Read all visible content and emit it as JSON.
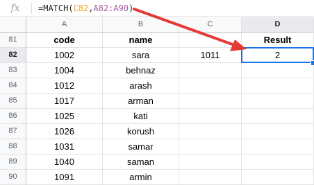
{
  "formula_bar": {
    "fx_icon": "fx-icon",
    "prefix": "=MATCH(",
    "ref1": "C82",
    "sep": ",",
    "ref2": "A82:A90",
    "suffix": ")"
  },
  "columns": [
    "A",
    "B",
    "C",
    "D"
  ],
  "rows": [
    {
      "num": "81",
      "a": "code",
      "b": "name",
      "c": "",
      "d": "Result"
    },
    {
      "num": "82",
      "a": "1002",
      "b": "sara",
      "c": "1011",
      "d": "2"
    },
    {
      "num": "83",
      "a": "1004",
      "b": "behnaz",
      "c": "",
      "d": ""
    },
    {
      "num": "84",
      "a": "1012",
      "b": "arash",
      "c": "",
      "d": ""
    },
    {
      "num": "85",
      "a": "1017",
      "b": "arman",
      "c": "",
      "d": ""
    },
    {
      "num": "86",
      "a": "1025",
      "b": "kati",
      "c": "",
      "d": ""
    },
    {
      "num": "87",
      "a": "1026",
      "b": "korush",
      "c": "",
      "d": ""
    },
    {
      "num": "88",
      "a": "1031",
      "b": "samar",
      "c": "",
      "d": ""
    },
    {
      "num": "89",
      "a": "1040",
      "b": "saman",
      "c": "",
      "d": ""
    },
    {
      "num": "90",
      "a": "1091",
      "b": "armin",
      "c": "",
      "d": ""
    }
  ],
  "colors": {
    "ref1": "#f5a623",
    "ref2": "#a55aa5",
    "selection": "#1a73e8",
    "arrow": "#e53935"
  }
}
